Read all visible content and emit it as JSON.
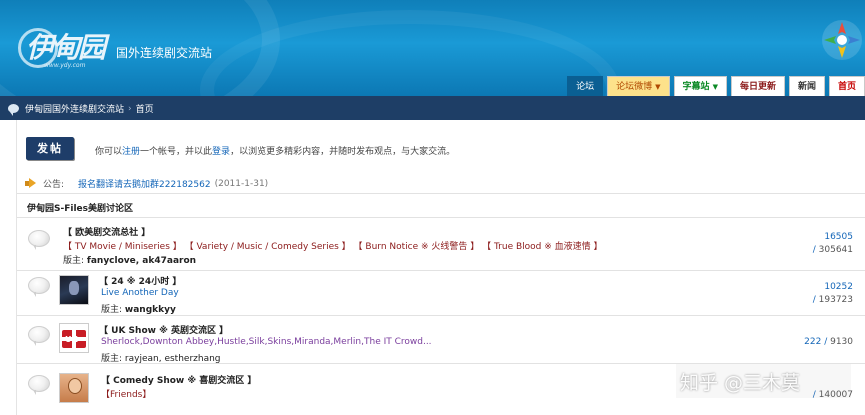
{
  "header": {
    "logo_text": "伊甸园",
    "logo_url": "www.ydy.com",
    "slogan": "国外连续剧交流站"
  },
  "nav": [
    {
      "label": "论坛",
      "style": "active"
    },
    {
      "label": "论坛微博",
      "style": "yellow",
      "caret": "▼"
    },
    {
      "label": "字幕站",
      "style": "green",
      "caret": "▼"
    },
    {
      "label": "每日更新",
      "style": "maroon"
    },
    {
      "label": "新闻",
      "style": "dark"
    },
    {
      "label": "首页",
      "style": "red"
    }
  ],
  "breadcrumb": {
    "root": "伊甸园国外连续剧交流站",
    "separator": "›",
    "current": "首页"
  },
  "post_button": "发帖",
  "welcome": {
    "prefix": "你可以",
    "register_link": "注册",
    "middle": "一个帐号，并以此",
    "login_link": "登录",
    "suffix": "，以浏览更多精彩内容，并随时发布观点，与大家交流。"
  },
  "announcement": {
    "label": "公告:",
    "message": "报名翻译请去鹅加群222182562",
    "date": "(2011-1-31)"
  },
  "section_title": "伊甸园S-Files美剧讨论区",
  "forums": [
    {
      "name": "【 欧美剧交流总社 】",
      "subforums": "【 TV Movie / Miniseries 】 【 Variety / Music / Comedy Series 】 【 Burn Notice ※ 火线警告 】 【 True Blood ※ 血液速情 】",
      "mod_label": "版主:",
      "mods": "fanyclove, ak47aaron",
      "threads": "16505",
      "posts": "305641"
    },
    {
      "name": "【 24 ※ 24小时 】",
      "subforums": "Live Another Day",
      "mod_label": "版主:",
      "mods": "wangkkyy",
      "threads": "10252",
      "posts": "193723"
    },
    {
      "name": "【 UK Show ※ 英剧交流区 】",
      "subforums": "Sherlock,Downton Abbey,Hustle,Silk,Skins,Miranda,Merlin,The IT Crowd...",
      "mod_label": "版主:",
      "mods": "rayjean, estherzhang",
      "threads": "222",
      "posts": "9130"
    },
    {
      "name": "【 Comedy Show ※ 喜剧交流区 】",
      "subforums": "【Friends】",
      "mod_label": "",
      "mods": "",
      "threads": "",
      "posts": "140007"
    }
  ],
  "watermark": "知乎 @三木莫",
  "colors": {
    "header_blue": "#1a9ad6",
    "breadcrumb_bar": "#1e3e66",
    "link_blue": "#1466b8",
    "post_button": "#1e3d69"
  }
}
